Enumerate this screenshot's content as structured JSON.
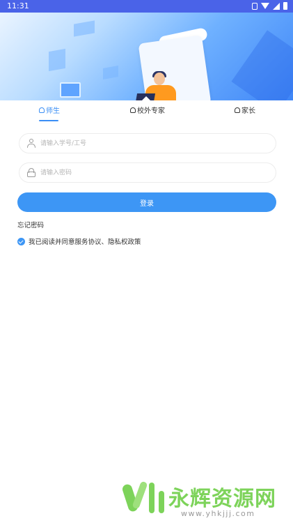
{
  "status_bar": {
    "time": "11:31",
    "icons": [
      "vibrate-icon",
      "wifi-icon",
      "signal-icon",
      "battery-icon"
    ],
    "background": "#4a63e8"
  },
  "tabs": [
    {
      "label": "师生",
      "icon": "person-icon",
      "selected": true
    },
    {
      "label": "校外专家",
      "icon": "person-icon",
      "selected": false
    },
    {
      "label": "家长",
      "icon": "person-icon",
      "selected": false
    }
  ],
  "form": {
    "username_placeholder": "请输入学号/工号",
    "username_icon": "user-icon",
    "password_placeholder": "请输入密码",
    "password_icon": "lock-icon",
    "login_label": "登录",
    "forgot_label": "忘记密码",
    "agreement_label": "我已阅读并同意服务协议、隐私权政策",
    "agreement_checked": true
  },
  "watermark": {
    "name": "永辉资源网",
    "url": "www.yhkjjj.com"
  },
  "colors": {
    "accent": "#3d96f5",
    "watermark_green": "#7dd35a"
  }
}
